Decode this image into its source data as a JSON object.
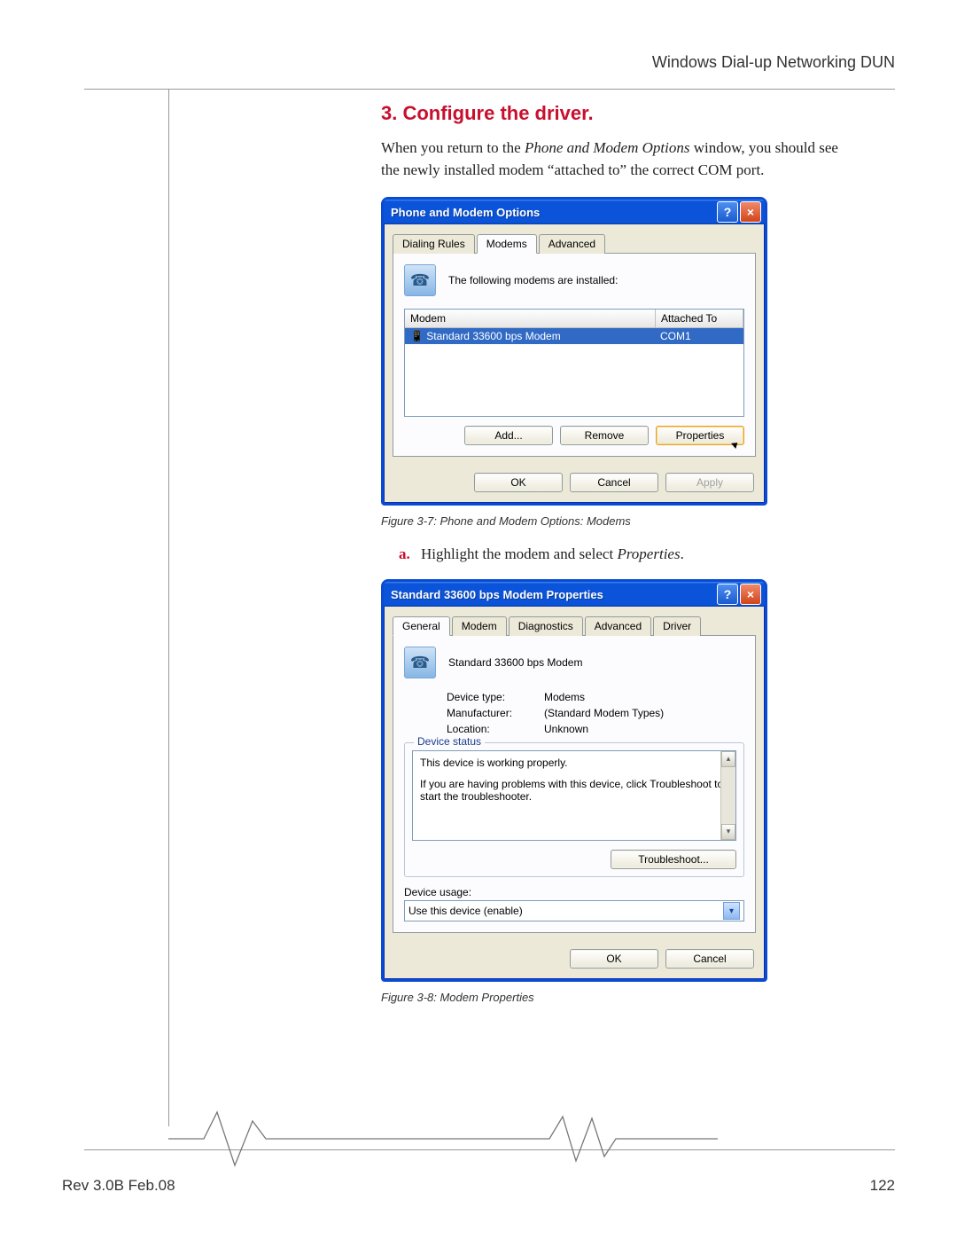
{
  "header": {
    "breadcrumb": "Windows Dial-up Networking DUN"
  },
  "section": {
    "title": "3. Configure the driver.",
    "intro_pre": "When you return to the ",
    "intro_ital": "Phone and Modem Options",
    "intro_post": " window, you should see the newly installed modem “attached to” the correct COM port."
  },
  "fig1": {
    "title": "Phone and Modem Options",
    "tabs": [
      "Dialing Rules",
      "Modems",
      "Advanced"
    ],
    "active_tab": 1,
    "msg": "The following modems are installed:",
    "col_modem": "Modem",
    "col_attached": "Attached To",
    "row_modem": "Standard 33600 bps Modem",
    "row_attached": "COM1",
    "btn_add": "Add...",
    "btn_remove": "Remove",
    "btn_props": "Properties",
    "btn_ok": "OK",
    "btn_cancel": "Cancel",
    "btn_apply": "Apply",
    "caption": "Figure 3-7: Phone and Modem Options: Modems"
  },
  "step_a": {
    "lbl": "a.",
    "text_pre": "Highlight the modem and select ",
    "text_ital": "Properties",
    "text_post": "."
  },
  "fig2": {
    "title": "Standard 33600 bps Modem Properties",
    "tabs": [
      "General",
      "Modem",
      "Diagnostics",
      "Advanced",
      "Driver"
    ],
    "active_tab": 0,
    "name": "Standard 33600 bps Modem",
    "k_dev": "Device type:",
    "v_dev": "Modems",
    "k_man": "Manufacturer:",
    "v_man": "(Standard Modem Types)",
    "k_loc": "Location:",
    "v_loc": "Unknown",
    "grp_label": "Device status",
    "status_l1": "This device is working properly.",
    "status_l2": "If you are having problems with this device, click Troubleshoot to start the troubleshooter.",
    "btn_trouble": "Troubleshoot...",
    "usage_label": "Device usage:",
    "usage_value": "Use this device (enable)",
    "btn_ok": "OK",
    "btn_cancel": "Cancel",
    "caption": "Figure 3-8: Modem Properties"
  },
  "footer": {
    "rev": "Rev 3.0B Feb.08",
    "page": "122"
  }
}
